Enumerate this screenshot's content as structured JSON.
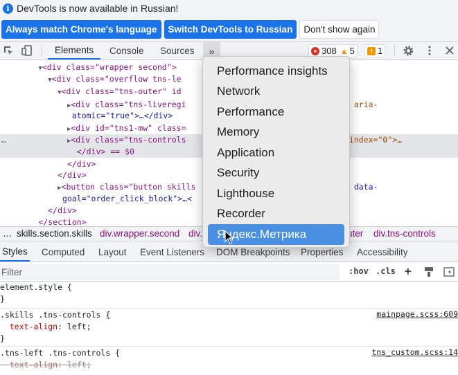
{
  "infobar": {
    "message": "DevTools is now available in Russian!",
    "btn_match": "Always match Chrome's language",
    "btn_switch": "Switch DevTools to Russian",
    "btn_dismiss": "Don't show again"
  },
  "toolbar": {
    "tabs": [
      "Elements",
      "Console",
      "Sources"
    ],
    "more_tabs_glyph": "»",
    "errors_count": "308",
    "warnings_count": "5",
    "issues_count": "1"
  },
  "dom_tree": {
    "line0": "<div class=\"wrapper second\">",
    "line1": "<div class=\"overflow tns-le",
    "line2": "<div class=\"tns-outer\" id",
    "line3a": "<div class=\"tns-liveregi",
    "line3b": "live=\"polite\" aria-",
    "line4": "atomic=\"true\">…</div>",
    "line5": "<div id=\"tns1-mw\" class=",
    "line6a": "<div class=\"tns-controls",
    "line6b": "tion\" tabindex=\"0\">…",
    "line7": "</div> == $0",
    "line8": "</div>",
    "line9": "</div>",
    "line10a": "<button class=\"button skills",
    "line10b": "ent open-popup\" data-",
    "line11": "goal=\"order_click_block\">…<",
    "line12": "</div>",
    "line13": "</section>"
  },
  "breadcrumb": {
    "items": [
      "…",
      "skills.section.skills",
      "div.wrapper.second",
      "div.o",
      "uter",
      "div.tns-controls"
    ]
  },
  "subtabs": [
    "Styles",
    "Computed",
    "Layout",
    "Event Listeners",
    "DOM Breakpoints",
    "Properties",
    "Accessibility"
  ],
  "filter": {
    "placeholder": "Filter",
    "hov": ":hov",
    "cls": ".cls",
    "plus": "+"
  },
  "styles": {
    "rule0_selector": "element.style {",
    "rule0_close": "}",
    "rule1_selector": ".skills .tns-controls {",
    "rule1_prop": "text-align",
    "rule1_value": "left;",
    "rule1_close": "}",
    "rule1_source": "mainpage.scss:609",
    "rule2_selector": ".tns-left .tns-controls {",
    "rule2_prop": "text-align",
    "rule2_value": "left;",
    "rule2_source": "tns_custom.scss:14"
  },
  "dropdown": {
    "items": [
      "Performance insights",
      "Network",
      "Performance",
      "Memory",
      "Application",
      "Security",
      "Lighthouse",
      "Recorder",
      "Яндекс.Метрика"
    ],
    "highlighted": "Яндекс.Метрика"
  },
  "colors": {
    "accent": "#1a73e8",
    "menu_highlight": "#4a90e2",
    "error": "#d93025",
    "warning": "#f29900"
  }
}
